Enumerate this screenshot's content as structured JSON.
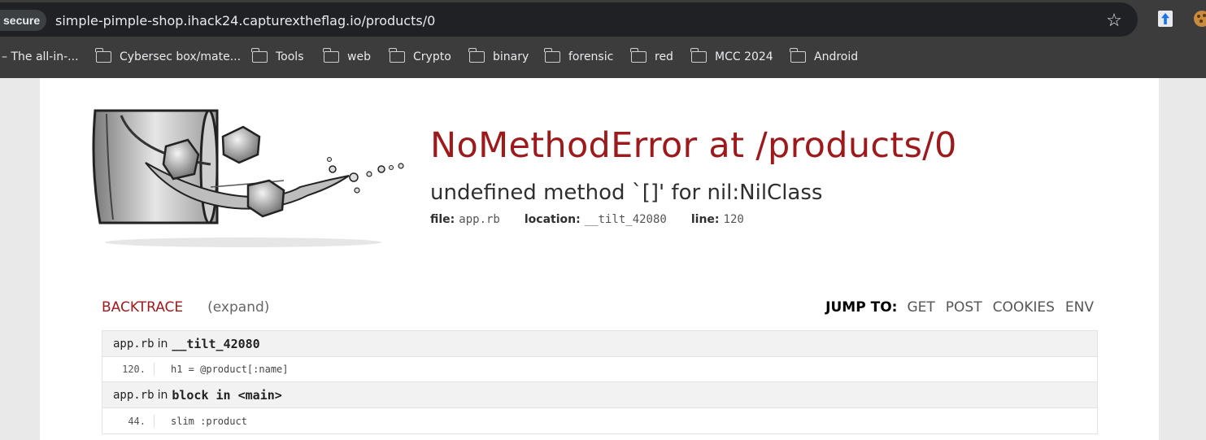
{
  "browser": {
    "security_chip": "secure",
    "url": "simple-pimple-shop.ihack24.capturextheflag.io/products/0",
    "bookmarks": [
      {
        "label": "– The all-in-...",
        "folder": false
      },
      {
        "label": "Cybersec box/mate...",
        "folder": true
      },
      {
        "label": "Tools",
        "folder": true
      },
      {
        "label": "web",
        "folder": true
      },
      {
        "label": "Crypto",
        "folder": true
      },
      {
        "label": "binary",
        "folder": true
      },
      {
        "label": "forensic",
        "folder": true
      },
      {
        "label": "red",
        "folder": true
      },
      {
        "label": "MCC 2024",
        "folder": true
      },
      {
        "label": "Android",
        "folder": true
      }
    ],
    "icons": [
      "star-icon",
      "extension-icon",
      "cookie-extension-icon"
    ]
  },
  "error": {
    "title": "NoMethodError at /products/0",
    "message": "undefined method `[]' for nil:NilClass",
    "file_label": "file:",
    "file_value": "app.rb",
    "location_label": "location:",
    "location_value": "__tilt_42080",
    "line_label": "line:",
    "line_value": "120"
  },
  "backtrace": {
    "title": "BACKTRACE",
    "expand": "(expand)",
    "jump_label": "JUMP TO:",
    "jump_links": [
      "GET",
      "POST",
      "COOKIES",
      "ENV"
    ],
    "frames": [
      {
        "file": "app.rb",
        "in": "in",
        "context": "__tilt_42080",
        "line": "120.",
        "code": "h1 = @product[:name]"
      },
      {
        "file": "app.rb",
        "in": "in",
        "context": "block in <main>",
        "line": "44.",
        "code": "slim :product"
      }
    ]
  },
  "colors": {
    "accent_red": "#9c1a1c",
    "chrome_dark": "#3c3c3c",
    "omnibox": "#202124"
  }
}
